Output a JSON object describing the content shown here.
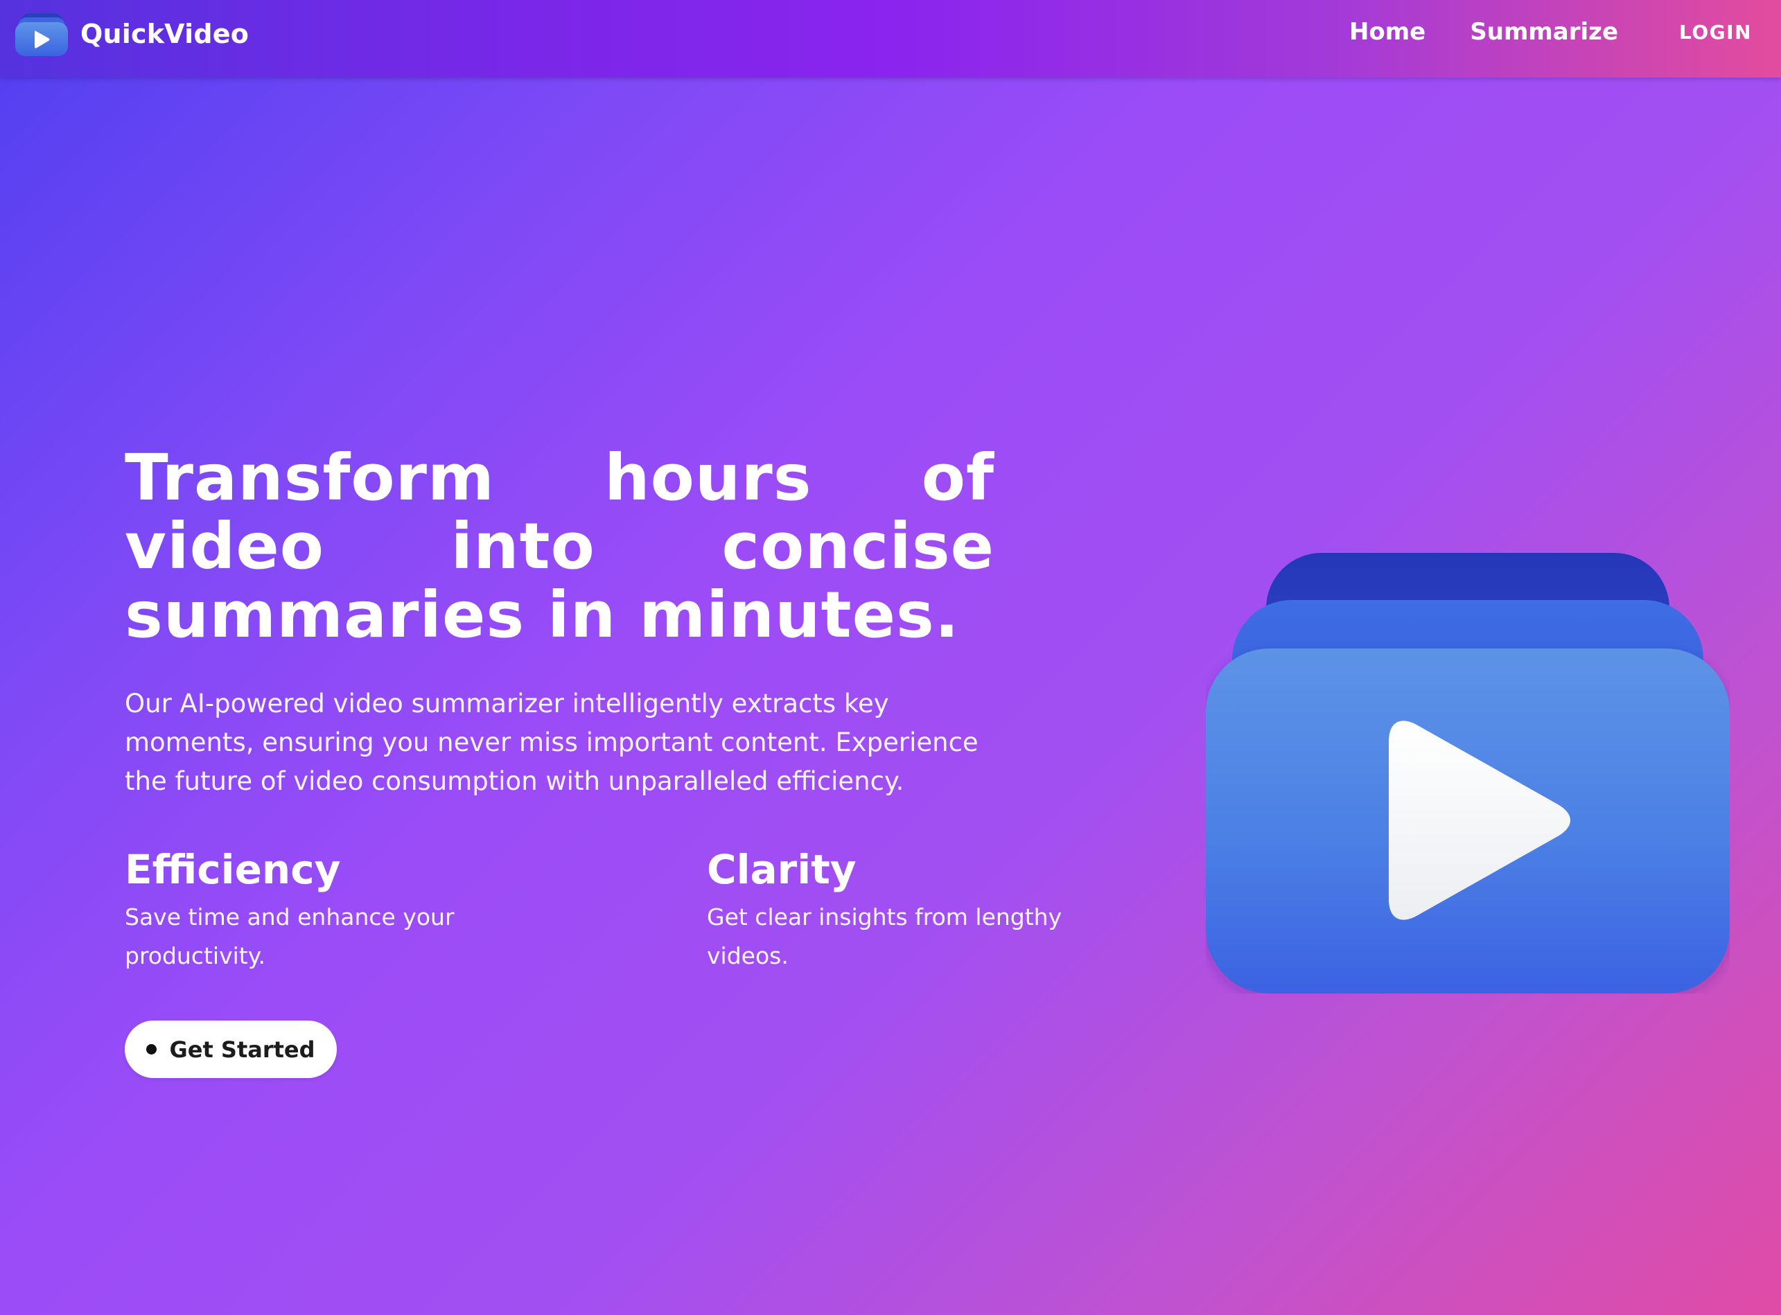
{
  "navbar": {
    "brand": "QuickVideo",
    "links": [
      "Home",
      "Summarize"
    ],
    "login": "LOGIN"
  },
  "hero": {
    "title": "Transform hours of video into concise summaries in minutes.",
    "description": "Our AI-powered video summarizer intelligently extracts key moments, ensuring you never miss important content. Experience the future of video consumption with unparalleled efficiency.",
    "features": [
      {
        "title": "Efficiency",
        "text": "Save time and enhance your productivity."
      },
      {
        "title": "Clarity",
        "text": "Get clear insights from lengthy videos."
      }
    ],
    "cta": "Get Started"
  },
  "colors": {
    "navbar_start": "#5532de",
    "navbar_end": "#e34c9d",
    "background_start": "#4f3ff0",
    "background_mid": "#9c4cf7",
    "background_end": "#e04ca5",
    "illustration_blue": "#4a7ee6",
    "illustration_dark_blue": "#2437b8",
    "button_bg": "#ffffff",
    "button_text": "#1c1c1c"
  },
  "icons": {
    "brand_logo": "video-stack-play-icon",
    "hero_illustration": "video-stack-play-icon",
    "cta_bullet": "dot-icon"
  }
}
